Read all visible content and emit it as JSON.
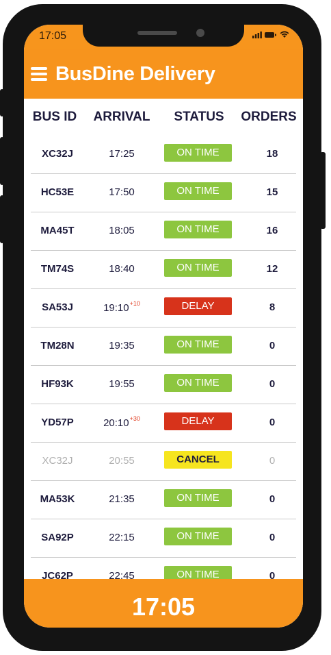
{
  "status_bar": {
    "time": "17:05"
  },
  "app": {
    "title": "BusDine Delivery"
  },
  "table": {
    "headers": {
      "bus_id": "BUS ID",
      "arrival": "ARRIVAL",
      "status": "STATUS",
      "orders": "ORDERS"
    },
    "rows": [
      {
        "bus_id": "XC32J",
        "arrival": "17:25",
        "delay": "",
        "status": "ON TIME",
        "orders": "18"
      },
      {
        "bus_id": "HC53E",
        "arrival": "17:50",
        "delay": "",
        "status": "ON TIME",
        "orders": "15"
      },
      {
        "bus_id": "MA45T",
        "arrival": "18:05",
        "delay": "",
        "status": "ON TIME",
        "orders": "16"
      },
      {
        "bus_id": "TM74S",
        "arrival": "18:40",
        "delay": "",
        "status": "ON TIME",
        "orders": "12"
      },
      {
        "bus_id": "SA53J",
        "arrival": "19:10",
        "delay": "+10",
        "status": "DELAY",
        "orders": "8"
      },
      {
        "bus_id": "TM28N",
        "arrival": "19:35",
        "delay": "",
        "status": "ON TIME",
        "orders": "0"
      },
      {
        "bus_id": "HF93K",
        "arrival": "19:55",
        "delay": "",
        "status": "ON TIME",
        "orders": "0"
      },
      {
        "bus_id": "YD57P",
        "arrival": "20:10",
        "delay": "+30",
        "status": "DELAY",
        "orders": "0"
      },
      {
        "bus_id": "XC32J",
        "arrival": "20:55",
        "delay": "",
        "status": "CANCEL",
        "orders": "0"
      },
      {
        "bus_id": "MA53K",
        "arrival": "21:35",
        "delay": "",
        "status": "ON TIME",
        "orders": "0"
      },
      {
        "bus_id": "SA92P",
        "arrival": "22:15",
        "delay": "",
        "status": "ON TIME",
        "orders": "0"
      },
      {
        "bus_id": "JC62P",
        "arrival": "22:45",
        "delay": "",
        "status": "ON TIME",
        "orders": "0"
      }
    ]
  },
  "footer": {
    "time": "17:05"
  },
  "colors": {
    "brand": "#f7941d",
    "on_time": "#8dc63f",
    "delay": "#d7331b",
    "cancel": "#f6e51f",
    "text": "#1d1b3c"
  }
}
